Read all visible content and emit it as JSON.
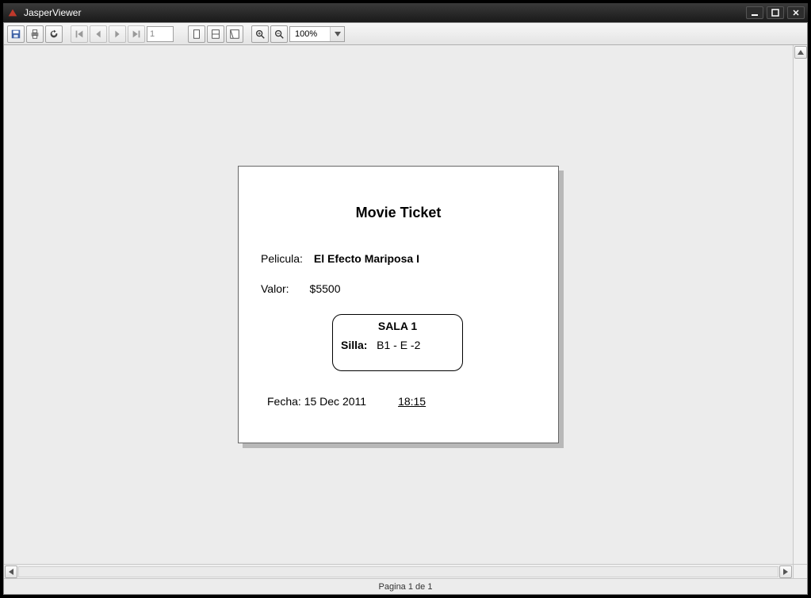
{
  "window": {
    "title": "JasperViewer"
  },
  "toolbar": {
    "page_field": "1",
    "zoom_value": "100%"
  },
  "statusbar": {
    "text": "Pagina 1 de 1"
  },
  "ticket": {
    "title": "Movie Ticket",
    "pelicula_label": "Pelicula:",
    "pelicula_value": "El Efecto Mariposa I",
    "valor_label": "Valor:",
    "valor_value": "$5500",
    "sala": "SALA  1",
    "silla_label": "Silla:",
    "silla_value": "B1 - E   -2",
    "fecha_label": "Fecha:",
    "fecha_value": "15 Dec 2011",
    "hora": "18:15"
  }
}
